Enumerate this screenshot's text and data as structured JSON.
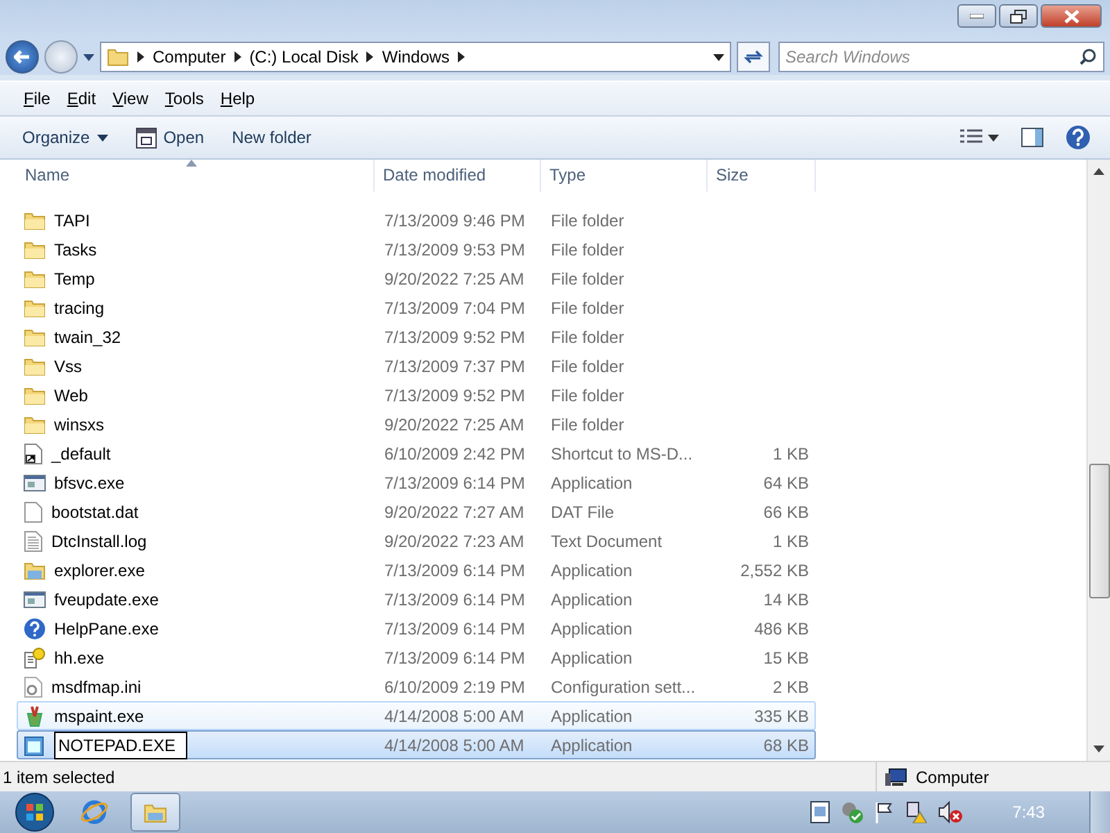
{
  "address": {
    "segments": [
      "Computer",
      "(C:) Local Disk",
      "Windows"
    ]
  },
  "search": {
    "placeholder": "Search Windows"
  },
  "menu": [
    "File",
    "Edit",
    "View",
    "Tools",
    "Help"
  ],
  "toolbar": {
    "organize": "Organize",
    "open": "Open",
    "new_folder": "New folder"
  },
  "table": {
    "columns": [
      "Name",
      "Date modified",
      "Type",
      "Size"
    ],
    "rows": [
      {
        "kind": "folder",
        "name": "TAPI",
        "date": "7/13/2009 9:46 PM",
        "type": "File folder",
        "size": "",
        "hovered": false,
        "selected": false
      },
      {
        "kind": "folder",
        "name": "Tasks",
        "date": "7/13/2009 9:53 PM",
        "type": "File folder",
        "size": "",
        "hovered": false,
        "selected": false
      },
      {
        "kind": "folder",
        "name": "Temp",
        "date": "9/20/2022 7:25 AM",
        "type": "File folder",
        "size": "",
        "hovered": false,
        "selected": false
      },
      {
        "kind": "folder",
        "name": "tracing",
        "date": "7/13/2009 7:04 PM",
        "type": "File folder",
        "size": "",
        "hovered": false,
        "selected": false
      },
      {
        "kind": "folder",
        "name": "twain_32",
        "date": "7/13/2009 9:52 PM",
        "type": "File folder",
        "size": "",
        "hovered": false,
        "selected": false
      },
      {
        "kind": "folder",
        "name": "Vss",
        "date": "7/13/2009 7:37 PM",
        "type": "File folder",
        "size": "",
        "hovered": false,
        "selected": false
      },
      {
        "kind": "folder",
        "name": "Web",
        "date": "7/13/2009 9:52 PM",
        "type": "File folder",
        "size": "",
        "hovered": false,
        "selected": false
      },
      {
        "kind": "folder",
        "name": "winsxs",
        "date": "9/20/2022 7:25 AM",
        "type": "File folder",
        "size": "",
        "hovered": false,
        "selected": false
      },
      {
        "kind": "shortcut",
        "name": "_default",
        "date": "6/10/2009 2:42 PM",
        "type": "Shortcut to MS-D...",
        "size": "1 KB",
        "hovered": false,
        "selected": false
      },
      {
        "kind": "app",
        "name": "bfsvc.exe",
        "date": "7/13/2009 6:14 PM",
        "type": "Application",
        "size": "64 KB",
        "hovered": false,
        "selected": false
      },
      {
        "kind": "file",
        "name": "bootstat.dat",
        "date": "9/20/2022 7:27 AM",
        "type": "DAT File",
        "size": "66 KB",
        "hovered": false,
        "selected": false
      },
      {
        "kind": "text",
        "name": "DtcInstall.log",
        "date": "9/20/2022 7:23 AM",
        "type": "Text Document",
        "size": "1 KB",
        "hovered": false,
        "selected": false
      },
      {
        "kind": "explorer",
        "name": "explorer.exe",
        "date": "7/13/2009 6:14 PM",
        "type": "Application",
        "size": "2,552 KB",
        "hovered": false,
        "selected": false
      },
      {
        "kind": "app",
        "name": "fveupdate.exe",
        "date": "7/13/2009 6:14 PM",
        "type": "Application",
        "size": "14 KB",
        "hovered": false,
        "selected": false
      },
      {
        "kind": "help",
        "name": "HelpPane.exe",
        "date": "7/13/2009 6:14 PM",
        "type": "Application",
        "size": "486 KB",
        "hovered": false,
        "selected": false
      },
      {
        "kind": "hh",
        "name": "hh.exe",
        "date": "7/13/2009 6:14 PM",
        "type": "Application",
        "size": "15 KB",
        "hovered": false,
        "selected": false
      },
      {
        "kind": "ini",
        "name": "msdfmap.ini",
        "date": "6/10/2009 2:19 PM",
        "type": "Configuration sett...",
        "size": "2 KB",
        "hovered": false,
        "selected": false
      },
      {
        "kind": "paint",
        "name": "mspaint.exe",
        "date": "4/14/2008 5:00 AM",
        "type": "Application",
        "size": "335 KB",
        "hovered": true,
        "selected": false
      },
      {
        "kind": "notepad",
        "name": "NOTEPAD.EXE",
        "date": "4/14/2008 5:00 AM",
        "type": "Application",
        "size": "68 KB",
        "hovered": false,
        "selected": true,
        "renaming": true
      }
    ]
  },
  "status": {
    "text": "1 item selected",
    "location": "Computer"
  },
  "taskbar": {
    "clock": "7:43"
  }
}
